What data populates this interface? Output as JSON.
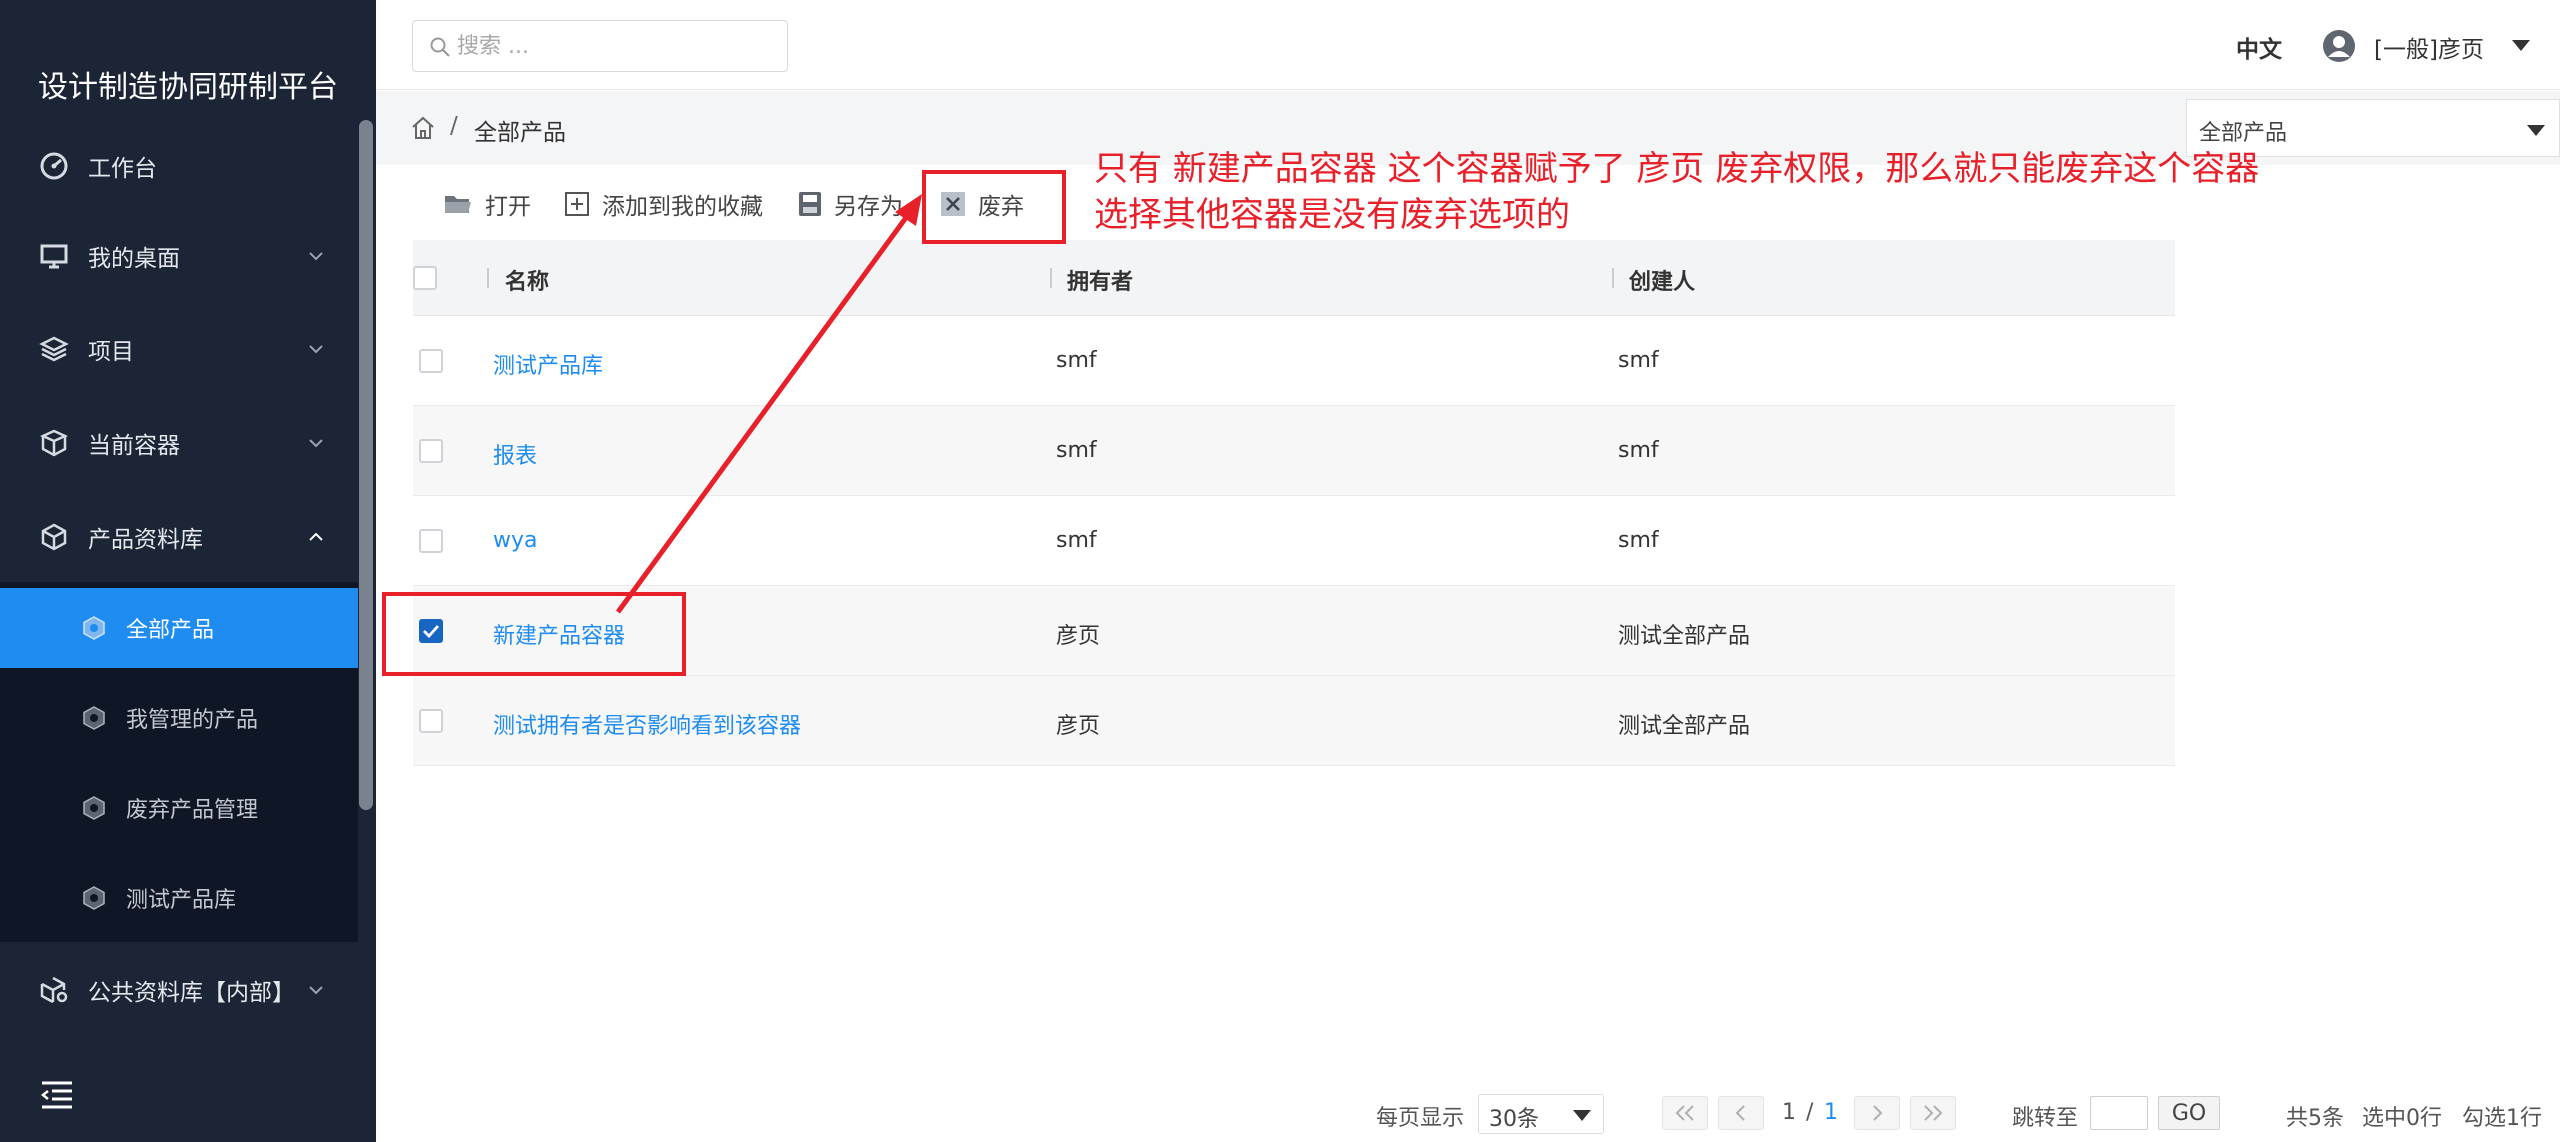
{
  "app": {
    "title": "设计制造协同研制平台"
  },
  "sidebar": {
    "items": [
      {
        "label": "工作台"
      },
      {
        "label": "我的桌面"
      },
      {
        "label": "项目"
      },
      {
        "label": "当前容器"
      },
      {
        "label": "产品资料库"
      },
      {
        "label": "公共资料库【内部】"
      }
    ],
    "subitems": [
      {
        "label": "全部产品",
        "active": true
      },
      {
        "label": "我管理的产品"
      },
      {
        "label": "废弃产品管理"
      },
      {
        "label": "测试产品库"
      }
    ],
    "accent": "#1e8cf0"
  },
  "header": {
    "search_placeholder": "搜索 ...",
    "language": "中文",
    "user": "[一般]彦页"
  },
  "breadcrumb": {
    "current": "全部产品",
    "separator": "/"
  },
  "context_select": {
    "value": "全部产品"
  },
  "toolbar": {
    "open": "打开",
    "add_favorite": "添加到我的收藏",
    "save_as": "另存为",
    "discard": "废弃"
  },
  "table": {
    "columns": [
      "名称",
      "拥有者",
      "创建人"
    ],
    "rows": [
      {
        "name": "测试产品库",
        "owner": "smf",
        "creator": "smf",
        "checked": false
      },
      {
        "name": "报表",
        "owner": "smf",
        "creator": "smf",
        "checked": false
      },
      {
        "name": "wya",
        "owner": "smf",
        "creator": "smf",
        "checked": false
      },
      {
        "name": "新建产品容器",
        "owner": "彦页",
        "creator": "测试全部产品",
        "checked": true
      },
      {
        "name": "测试拥有者是否影响看到该容器",
        "owner": "彦页",
        "creator": "测试全部产品",
        "checked": false
      }
    ]
  },
  "annotation": {
    "line1": "只有 新建产品容器 这个容器赋予了 彦页 废弃权限，那么就只能废弃这个容器",
    "line2": "选择其他容器是没有废弃选项的",
    "color": "#e8202a"
  },
  "pagination": {
    "per_page_label": "每页显示",
    "per_page_value": "30条",
    "page_current": "1",
    "page_sep": "/",
    "page_total": "1",
    "jump_label": "跳转至",
    "go_label": "GO",
    "total_label": "共5条",
    "selected_label": "选中0行",
    "checked_label": "勾选1行"
  }
}
